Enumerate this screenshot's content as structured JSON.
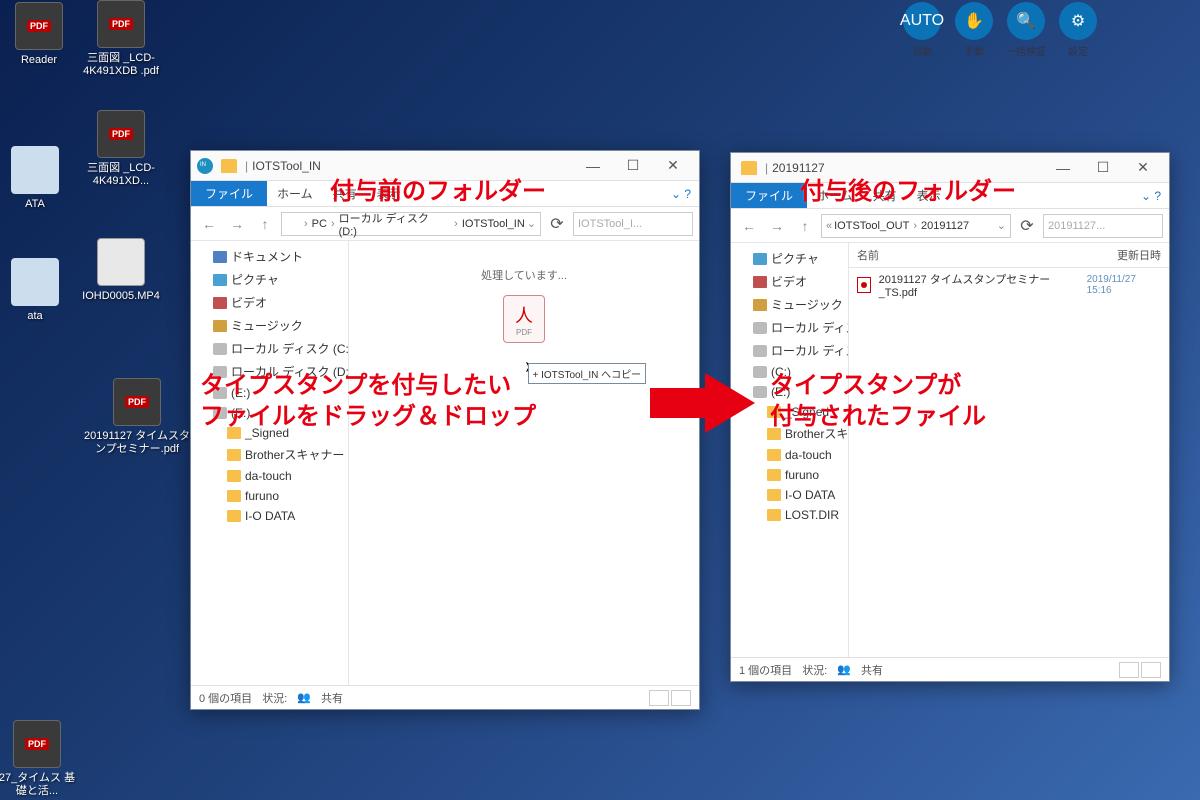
{
  "desktop": {
    "icons": [
      {
        "label": "Reader",
        "type": "app"
      },
      {
        "label": "三面図\n_LCD-4K491XDB\n.pdf"
      },
      {
        "label": "三面図\n_LCD-4K491XD..."
      },
      {
        "label": "ATA"
      },
      {
        "label": "ata"
      },
      {
        "label": "IOHD0005.MP4"
      },
      {
        "label": "20191127 タイムスタ\nンプセミナー.pdf"
      },
      {
        "label": "27_タイムス\n基礎と活..."
      }
    ]
  },
  "toolbar": {
    "buttons": [
      {
        "icon": "AUTO",
        "label": "自動"
      },
      {
        "icon": "✋",
        "label": "手動"
      },
      {
        "icon": "🔍",
        "label": "一括検証"
      },
      {
        "icon": "⚙",
        "label": "設定"
      }
    ]
  },
  "windowLeft": {
    "title": "IOTSTool_IN",
    "ribbon": {
      "file": "ファイル",
      "tabs": [
        "ホーム",
        "共有",
        "表示"
      ]
    },
    "breadcrumb": [
      "PC",
      "ローカル ディスク (D:)",
      "IOTSTool_IN"
    ],
    "searchPlaceholder": "IOTSTool_I...",
    "nav": [
      {
        "label": "ドキュメント",
        "cls": "doc"
      },
      {
        "label": "ピクチャ",
        "cls": "pic"
      },
      {
        "label": "ビデオ",
        "cls": "vid"
      },
      {
        "label": "ミュージック",
        "cls": "mus"
      },
      {
        "label": "ローカル ディスク (C:)",
        "cls": "drive"
      },
      {
        "label": "ローカル ディスク (D:)",
        "cls": "drive"
      },
      {
        "label": "(E:)",
        "cls": "drive"
      },
      {
        "label": "(E:)",
        "cls": "drive"
      },
      {
        "label": "_Signed",
        "sub": true
      },
      {
        "label": "Brotherスキャナー",
        "sub": true
      },
      {
        "label": "da-touch",
        "sub": true
      },
      {
        "label": "furuno",
        "sub": true
      },
      {
        "label": "I-O DATA",
        "sub": true
      }
    ],
    "processing": "処理しています...",
    "dropTip": "+ IOTSTool_IN へコピー",
    "status": {
      "count": "0 個の項目",
      "state": "状況:",
      "share": "共有"
    }
  },
  "windowRight": {
    "title": "20191127",
    "ribbon": {
      "file": "ファイル",
      "tabs": [
        "ホーム",
        "共有",
        "表示"
      ]
    },
    "breadcrumb": [
      "IOTSTool_OUT",
      "20191127"
    ],
    "searchPlaceholder": "20191127...",
    "columns": {
      "name": "名前",
      "date": "更新日時"
    },
    "files": [
      {
        "name": "20191127 タイムスタンプセミナー_TS.pdf",
        "date": "2019/11/27 15:16"
      }
    ],
    "nav": [
      {
        "label": "ピクチャ",
        "cls": "pic"
      },
      {
        "label": "ビデオ",
        "cls": "vid"
      },
      {
        "label": "ミュージック",
        "cls": "mus"
      },
      {
        "label": "ローカル ディスク (C:)",
        "cls": "drive"
      },
      {
        "label": "ローカル ディスク (D:)",
        "cls": "drive"
      },
      {
        "label": "(C:)",
        "cls": "drive"
      },
      {
        "label": "(E:)",
        "cls": "drive"
      },
      {
        "label": "_Signed",
        "sub": true
      },
      {
        "label": "Brotherスキャナー",
        "sub": true
      },
      {
        "label": "da-touch",
        "sub": true
      },
      {
        "label": "furuno",
        "sub": true
      },
      {
        "label": "I-O DATA",
        "sub": true
      },
      {
        "label": "LOST.DIR",
        "sub": true
      }
    ],
    "status": {
      "count": "1 個の項目",
      "state": "状況:",
      "share": "共有"
    }
  },
  "annotations": {
    "beforeFolder": "付与前のフォルダー",
    "afterFolder": "付与後のフォルダー",
    "dragDrop": "タイプスタンプを付与したい\nファイルをドラッグ＆ドロップ",
    "stamped": "タイプスタンプが\n付与されたファイル"
  }
}
